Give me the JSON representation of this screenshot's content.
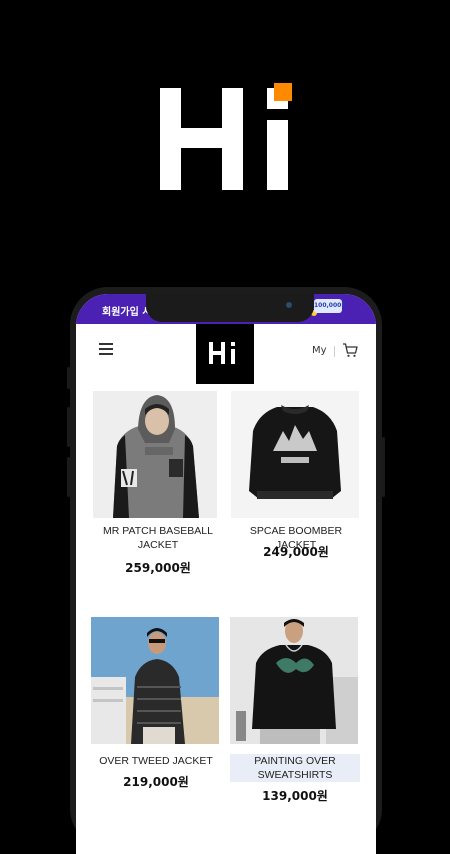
{
  "banner": {
    "text": "회원가입 시",
    "suffix": "!!",
    "coupon": "100,000P"
  },
  "header": {
    "my_label": "My"
  },
  "products": [
    {
      "name": "MR PATCH BASEBALL JACKET",
      "price": "259,000원"
    },
    {
      "name": "SPCAE BOOMBER JACKET",
      "price": "249,000원"
    },
    {
      "name": "OVER TWEED JACKET",
      "price": "219,000원"
    },
    {
      "name": "PAINTING OVER SWEATSHIRTS",
      "price": "139,000원"
    }
  ],
  "print_text": {
    "jacket2": "NASASPACE"
  },
  "colors": {
    "banner": "#4b21b3",
    "logo_accent": "#ff8a00",
    "background": "#000000"
  },
  "icons": [
    "menu-icon",
    "cart-icon"
  ]
}
